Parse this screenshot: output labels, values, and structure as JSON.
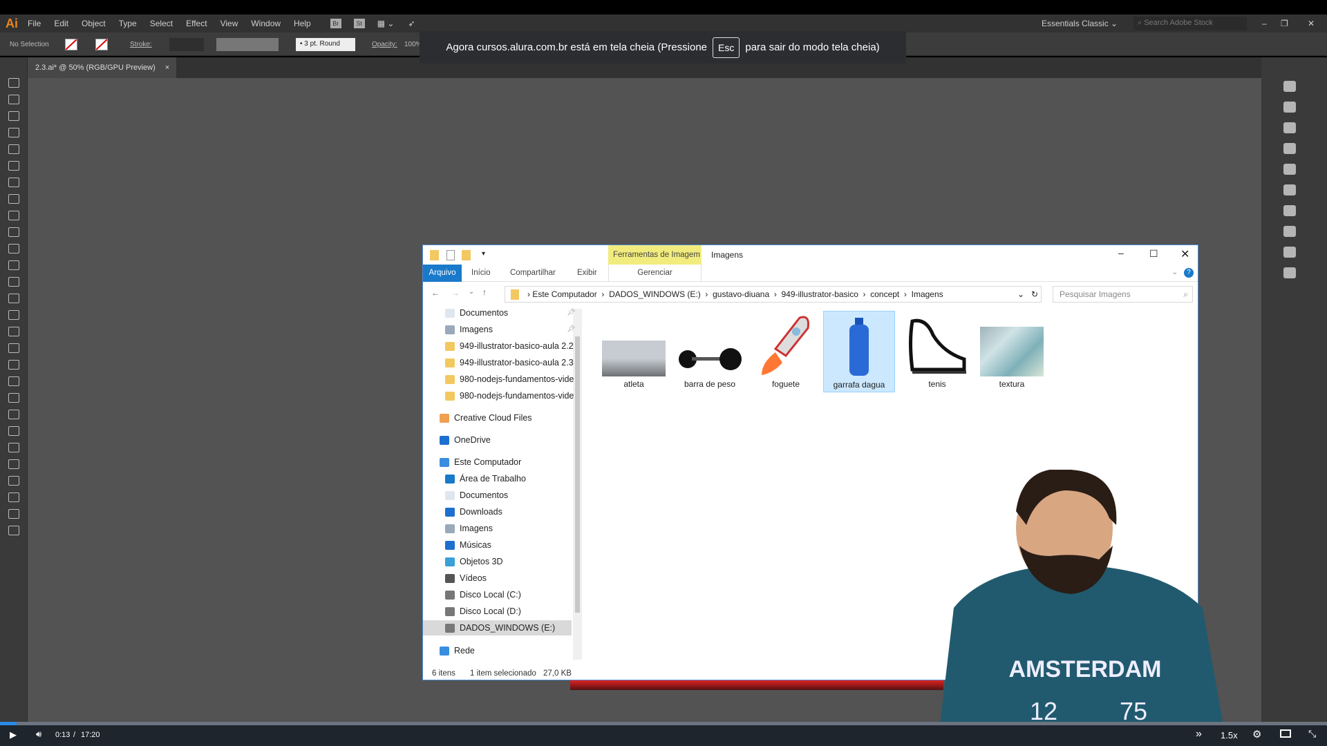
{
  "illustrator": {
    "logo": "Ai",
    "menu": [
      "File",
      "Edit",
      "Object",
      "Type",
      "Select",
      "Effect",
      "View",
      "Window",
      "Help"
    ],
    "app_icons": [
      "Br",
      "St"
    ],
    "workspace": "Essentials Classic",
    "stock_search_placeholder": "Search Adobe Stock",
    "control": {
      "selection": "No Selection",
      "stroke_label": "Stroke:",
      "brush": "3 pt. Round",
      "opacity_label": "Opacity:",
      "opacity": "100%"
    },
    "doc_tab": "2.3.ai* @ 50% (RGB/GPU Preview)",
    "doc_tab_close": "×"
  },
  "notice": {
    "before": "Agora cursos.alura.com.br está em tela cheia (Pressione",
    "key": "Esc",
    "after": "para sair do modo tela cheia)"
  },
  "explorer": {
    "context_tab": "Ferramentas de Imagem",
    "title": "Imagens",
    "ribbon_tabs": [
      "Arquivo",
      "Início",
      "Compartilhar",
      "Exibir"
    ],
    "context_sub": "Gerenciar",
    "path": [
      "Este Computador",
      "DADOS_WINDOWS (E:)",
      "gustavo-diuana",
      "949-illustrator-basico",
      "concept",
      "Imagens"
    ],
    "search_placeholder": "Pesquisar Imagens",
    "nav": [
      {
        "label": "Documentos",
        "icon": "document-icon",
        "pinned": true
      },
      {
        "label": "Imagens",
        "icon": "pictures-icon",
        "pinned": true
      },
      {
        "label": "949-illustrator-basico-aula 2.2",
        "icon": "folder-icon"
      },
      {
        "label": "949-illustrator-basico-aula 2.3",
        "icon": "folder-icon"
      },
      {
        "label": "980-nodejs-fundamentos-vide",
        "icon": "folder-icon"
      },
      {
        "label": "980-nodejs-fundamentos-vide",
        "icon": "folder-icon"
      },
      {
        "label": "Creative Cloud Files",
        "icon": "creative-cloud-icon"
      },
      {
        "label": "OneDrive",
        "icon": "onedrive-icon"
      },
      {
        "label": "Este Computador",
        "icon": "computer-icon"
      },
      {
        "label": "Área de Trabalho",
        "icon": "desktop-icon"
      },
      {
        "label": "Documentos",
        "icon": "document-icon"
      },
      {
        "label": "Downloads",
        "icon": "download-icon"
      },
      {
        "label": "Imagens",
        "icon": "pictures-icon"
      },
      {
        "label": "Músicas",
        "icon": "music-icon"
      },
      {
        "label": "Objetos 3D",
        "icon": "3d-objects-icon"
      },
      {
        "label": "Vídeos",
        "icon": "videos-icon"
      },
      {
        "label": "Disco Local (C:)",
        "icon": "drive-icon"
      },
      {
        "label": "Disco Local (D:)",
        "icon": "drive-icon"
      },
      {
        "label": "DADOS_WINDOWS (E:)",
        "icon": "drive-icon",
        "selected": true
      },
      {
        "label": "Rede",
        "icon": "network-icon"
      }
    ],
    "files": [
      {
        "name": "atleta"
      },
      {
        "name": "barra de peso"
      },
      {
        "name": "foguete"
      },
      {
        "name": "garrafa dagua",
        "selected": true
      },
      {
        "name": "tenis"
      },
      {
        "name": "textura"
      }
    ],
    "status": {
      "count": "6 itens",
      "selection": "1 item selecionado",
      "size": "27,0 KB"
    }
  },
  "shirt_text": {
    "line1": "AMSTERDAM",
    "line2": "12",
    "line3": "75"
  },
  "video": {
    "current": "0:13",
    "separator": "/",
    "duration": "17:20",
    "speed": "1.5x",
    "progress_fraction": 0.0125
  },
  "colors": {
    "accent": "#2b8ae8",
    "explorer_blue": "#1979ca",
    "context_yellow": "#f2ec7e"
  }
}
